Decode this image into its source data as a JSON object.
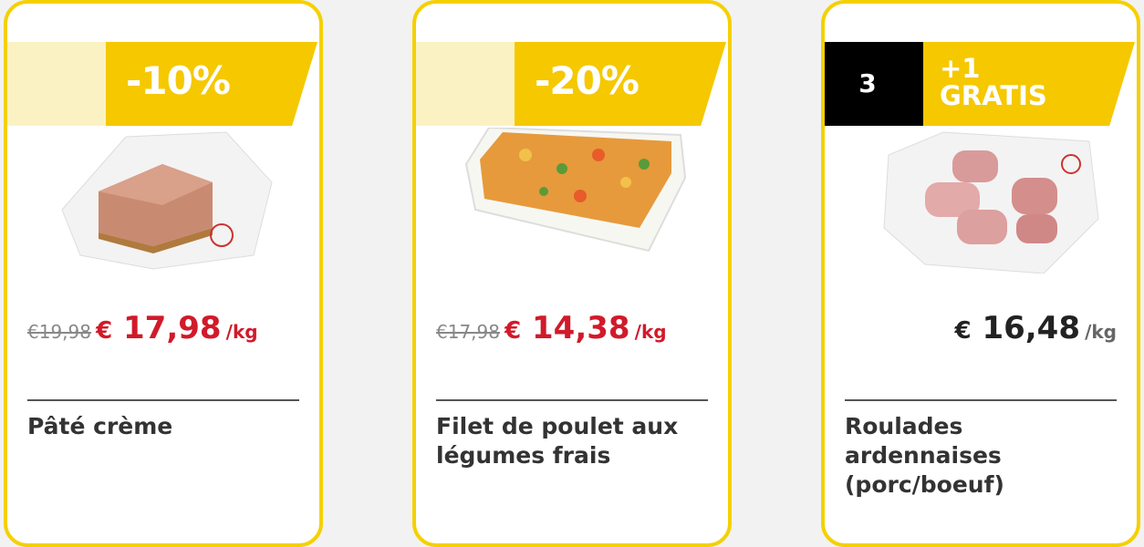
{
  "products": [
    {
      "badge": "-10%",
      "old_price": "€19,98",
      "price_euro": "€",
      "price": "17,98",
      "unit": "/kg",
      "name": "Pâté crème",
      "icon": "pate-image"
    },
    {
      "badge": "-20%",
      "old_price": "€17,98",
      "price_euro": "€",
      "price": "14,38",
      "unit": "/kg",
      "name": "Filet de poulet aux légumes frais",
      "icon": "chicken-vegetables-image"
    },
    {
      "badge_count": "3",
      "badge_plus": "+1",
      "badge_gratis": "GRATIS",
      "price_euro": "€",
      "price": "16,48",
      "unit": "/kg",
      "name": "Roulades ardennaises (porc/boeuf)",
      "icon": "roulades-image"
    }
  ],
  "colors": {
    "card_border": "#f5d000",
    "badge_yellow": "#f5c800",
    "badge_pale": "#fbf2c4",
    "price_red": "#d11a2a"
  }
}
